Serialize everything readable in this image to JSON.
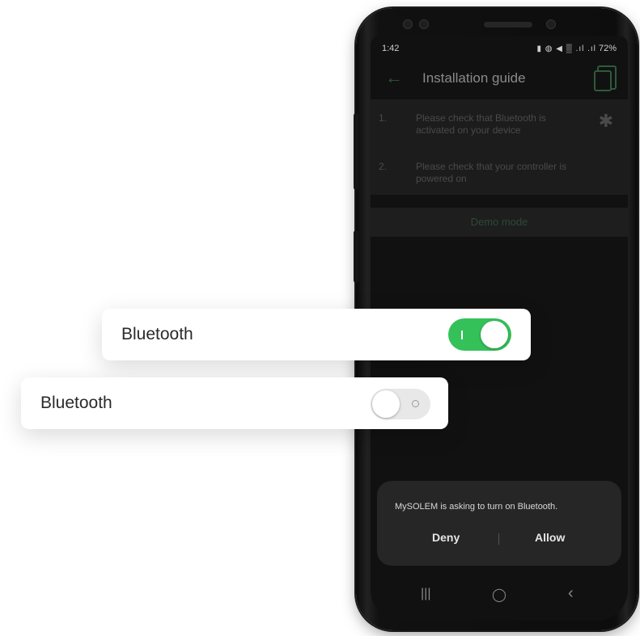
{
  "status_bar": {
    "time": "1:42",
    "icons": "▮ ◍ ◀ ▒ .ıl .ıl",
    "battery": "72%"
  },
  "app": {
    "back": "←",
    "title": "Installation guide"
  },
  "guide": {
    "steps": [
      {
        "num": "1.",
        "text": "Please check that Bluetooth is activated on your device"
      },
      {
        "num": "2.",
        "text": "Please check that your controller is powered on"
      }
    ],
    "bt_icon": "✱",
    "demo_label": "Demo mode"
  },
  "dialog": {
    "message": "MySOLEM is asking to turn on Bluetooth.",
    "deny": "Deny",
    "allow": "Allow"
  },
  "navbar": {
    "recents": "|||",
    "home": "◯",
    "back": "‹"
  },
  "cards": {
    "bluetooth_on": {
      "label": "Bluetooth",
      "state": "on"
    },
    "bluetooth_off": {
      "label": "Bluetooth",
      "state": "off"
    }
  },
  "colors": {
    "toggle_on": "#35c159",
    "toggle_off": "#e8e8e8",
    "accent_dim": "#2e5a3c"
  }
}
